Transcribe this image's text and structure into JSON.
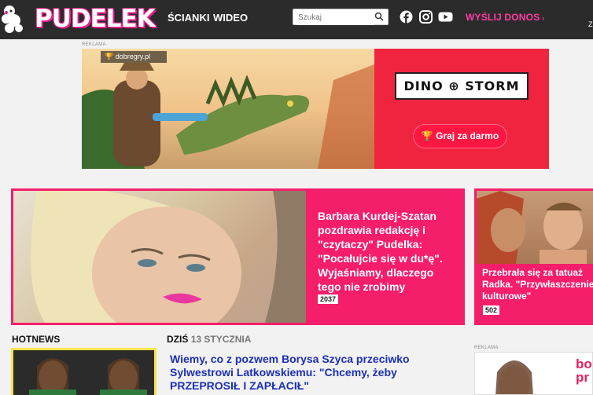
{
  "header": {
    "logo": "PUDELEK",
    "nav": [
      "ŚCIANKI",
      "WIDEO"
    ],
    "search_placeholder": "Szukaj",
    "donos_label": "WYŚLIJ DONOS",
    "social_icons": [
      "facebook-icon",
      "instagram-icon",
      "youtube-icon"
    ],
    "edge_char": "Z"
  },
  "ad_top": {
    "label": "REKLAMA",
    "sponsor": "dobregry.pl",
    "game_title": "DINO ⊕ STORM",
    "cta": "Graj za darmo"
  },
  "featured": {
    "title": "Barbara Kurdej-Szatan pozdrawia redakcję i \"czytaczy\" Pudelka: \"Pocałujcie się w du*ę\". Wyjaśniamy, dlaczego tego nie zrobimy",
    "count": "2037"
  },
  "side_story": {
    "title_lines": [
      "Przebrała się za tatuaż",
      "Radka. \"Przywłaszczenie",
      "kulturowe\""
    ],
    "count": "502"
  },
  "hotnews_label": "HOTNEWS",
  "today": {
    "prefix": "DZIŚ",
    "date": "13 STYCZNIA"
  },
  "headline": "Wiemy, co z pozwem Borysa Szyca przeciwko Sylwestrowi Latkowskiemu: \"Chcemy, żeby PRZEPROSIŁ I ZAPŁACIŁ\"",
  "ad_side": {
    "label": "REKLAMA",
    "letters": "bo\npr"
  },
  "colors": {
    "accent": "#f51e6b",
    "topbar": "#2b2b2b",
    "link": "#1c2fb5",
    "donos": "#ff3ea5"
  }
}
